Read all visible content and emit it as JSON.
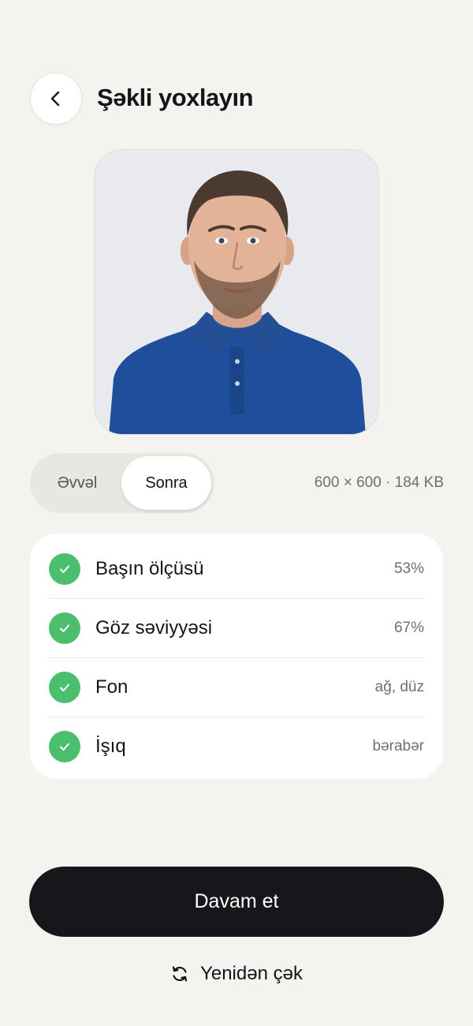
{
  "header": {
    "back_icon": "chevron-left-icon",
    "title": "Şəkli yoxlayın"
  },
  "photo": {
    "background_color": "#e8eaed",
    "shirt_color": "#1f4e9c"
  },
  "toggle": {
    "options": [
      "Əvvəl",
      "Sonra"
    ],
    "selected": "Sonra"
  },
  "file_info": "600 × 600 · 184 KB",
  "checks": [
    {
      "label": "Başın ölçüsü",
      "value": "53%",
      "status": "ok",
      "icon": "check-icon"
    },
    {
      "label": "Göz səviyyəsi",
      "value": "67%",
      "status": "ok",
      "icon": "check-icon"
    },
    {
      "label": "Fon",
      "value": "ağ, düz",
      "status": "ok",
      "icon": "check-icon"
    },
    {
      "label": "İşıq",
      "value": "bərabər",
      "status": "ok",
      "icon": "check-icon"
    }
  ],
  "colors": {
    "background": "#f4f3ef",
    "success": "#4cbf6e",
    "primary_button": "#17171b"
  },
  "actions": {
    "continue_label": "Davam et",
    "retake_label": "Yenidən çək",
    "retake_icon": "refresh-icon"
  }
}
